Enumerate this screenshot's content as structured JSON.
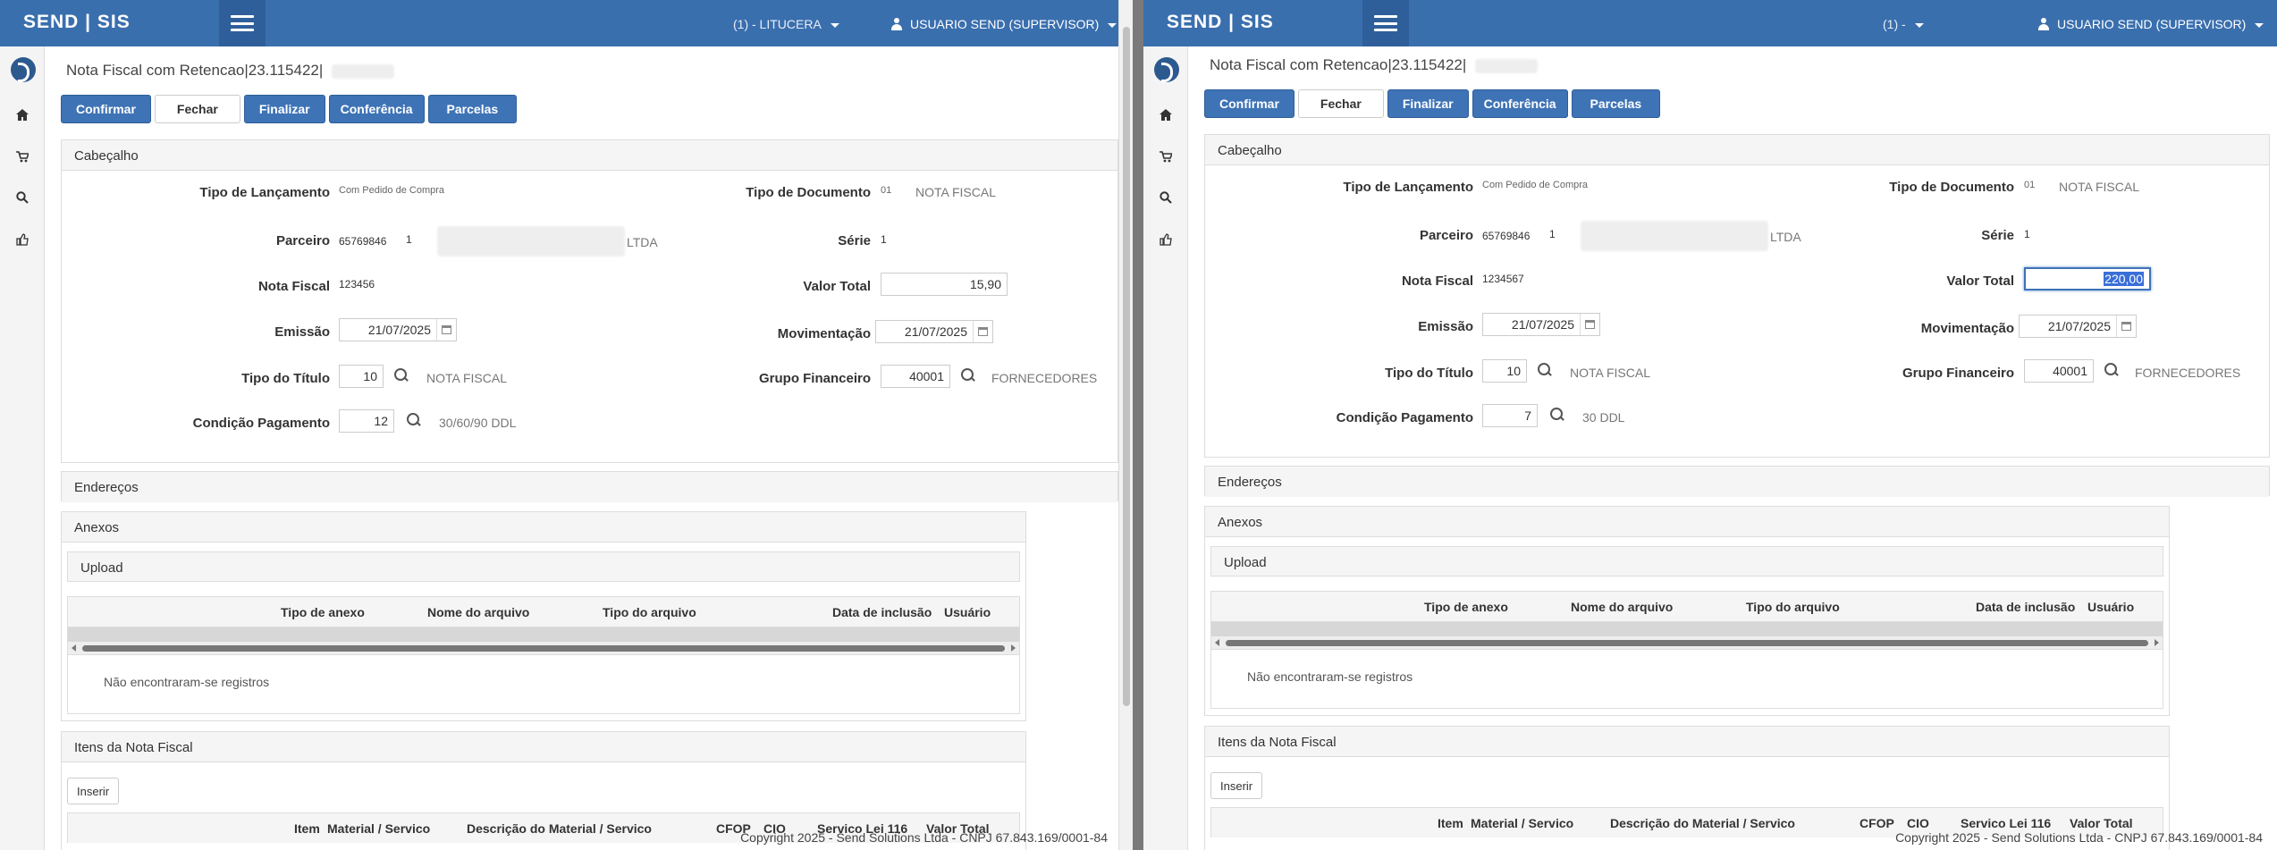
{
  "app": {
    "brand": "SEND | SIS"
  },
  "left": {
    "company": "(1) - LITUCERA",
    "user": "USUARIO SEND (SUPERVISOR)",
    "title": "Nota Fiscal com Retencao|23.115422|",
    "toolbar": {
      "confirm": "Confirmar",
      "close": "Fechar",
      "finish": "Finalizar",
      "check": "Conferência",
      "installments": "Parcelas"
    },
    "header": {
      "section_title": "Cabeçalho",
      "tipo_lancamento_label": "Tipo de Lançamento",
      "tipo_lancamento_value": "Com Pedido de Compra",
      "tipo_documento_label": "Tipo de Documento",
      "tipo_documento_code": "01",
      "tipo_documento_desc": "NOTA FISCAL",
      "parceiro_label": "Parceiro",
      "parceiro_code": "65769846",
      "parceiro_seq": "1",
      "parceiro_name": "LTDA",
      "serie_label": "Série",
      "serie_value": "1",
      "nota_fiscal_label": "Nota Fiscal",
      "nota_fiscal_value": "123456",
      "valor_total_label": "Valor Total",
      "valor_total_value": "15,90",
      "emissao_label": "Emissão",
      "emissao_value": "21/07/2025",
      "movimentacao_label": "Movimentação",
      "movimentacao_value": "21/07/2025",
      "tipo_titulo_label": "Tipo do Título",
      "tipo_titulo_code": "10",
      "tipo_titulo_desc": "NOTA FISCAL",
      "grupo_fin_label": "Grupo Financeiro",
      "grupo_fin_code": "40001",
      "grupo_fin_desc": "FORNECEDORES",
      "cond_pag_label": "Condição Pagamento",
      "cond_pag_code": "12",
      "cond_pag_desc": "30/60/90 DDL"
    },
    "addresses": "Endereços",
    "attachments": {
      "title": "Anexos",
      "upload": "Upload",
      "columns": [
        "Tipo de anexo",
        "Nome do arquivo",
        "Tipo do arquivo",
        "Data de inclusão",
        "Usuário"
      ],
      "empty": "Não encontraram-se registros"
    },
    "items": {
      "title": "Itens da Nota Fiscal",
      "insert": "Inserir",
      "columns": [
        "Item",
        "Material / Servico",
        "Descrição do Material / Servico",
        "CFOP",
        "CIO",
        "Servico Lei 116",
        "Valor Total"
      ]
    },
    "footer": "Copyright 2025 - Send Solutions Ltda - CNPJ 67.843.169/0001-84"
  },
  "right": {
    "company": "(1) -",
    "user": "USUARIO SEND (SUPERVISOR)",
    "title": "Nota Fiscal com Retencao|23.115422|",
    "toolbar": {
      "confirm": "Confirmar",
      "close": "Fechar",
      "finish": "Finalizar",
      "check": "Conferência",
      "installments": "Parcelas"
    },
    "header": {
      "section_title": "Cabeçalho",
      "tipo_lancamento_label": "Tipo de Lançamento",
      "tipo_lancamento_value": "Com Pedido de Compra",
      "tipo_documento_label": "Tipo de Documento",
      "tipo_documento_code": "01",
      "tipo_documento_desc": "NOTA FISCAL",
      "parceiro_label": "Parceiro",
      "parceiro_code": "65769846",
      "parceiro_seq": "1",
      "parceiro_name": "LTDA",
      "serie_label": "Série",
      "serie_value": "1",
      "nota_fiscal_label": "Nota Fiscal",
      "nota_fiscal_value": "1234567",
      "valor_total_label": "Valor Total",
      "valor_total_value": "220,00",
      "emissao_label": "Emissão",
      "emissao_value": "21/07/2025",
      "movimentacao_label": "Movimentação",
      "movimentacao_value": "21/07/2025",
      "tipo_titulo_label": "Tipo do Título",
      "tipo_titulo_code": "10",
      "tipo_titulo_desc": "NOTA FISCAL",
      "grupo_fin_label": "Grupo Financeiro",
      "grupo_fin_code": "40001",
      "grupo_fin_desc": "FORNECEDORES",
      "cond_pag_label": "Condição Pagamento",
      "cond_pag_code": "7",
      "cond_pag_desc": "30 DDL"
    },
    "addresses": "Endereços",
    "attachments": {
      "title": "Anexos",
      "upload": "Upload",
      "columns": [
        "Tipo de anexo",
        "Nome do arquivo",
        "Tipo do arquivo",
        "Data de inclusão",
        "Usuário"
      ],
      "empty": "Não encontraram-se registros"
    },
    "items": {
      "title": "Itens da Nota Fiscal",
      "insert": "Inserir",
      "columns": [
        "Item",
        "Material / Servico",
        "Descrição do Material / Servico",
        "CFOP",
        "CIO",
        "Servico Lei 116",
        "Valor Total"
      ]
    },
    "footer": "Copyright 2025 - Send Solutions Ltda - CNPJ 67.843.169/0001-84"
  },
  "icons": {
    "menu": "hamburger-icon",
    "home": "home-icon",
    "cart": "cart-icon",
    "search": "search-icon",
    "like": "thumbs-up-icon",
    "calendar": "calendar-icon",
    "user": "user-icon",
    "logo": "send-logo-icon"
  },
  "colors": {
    "topbar": "#3a6fae",
    "primary_button": "#3e73b6"
  }
}
